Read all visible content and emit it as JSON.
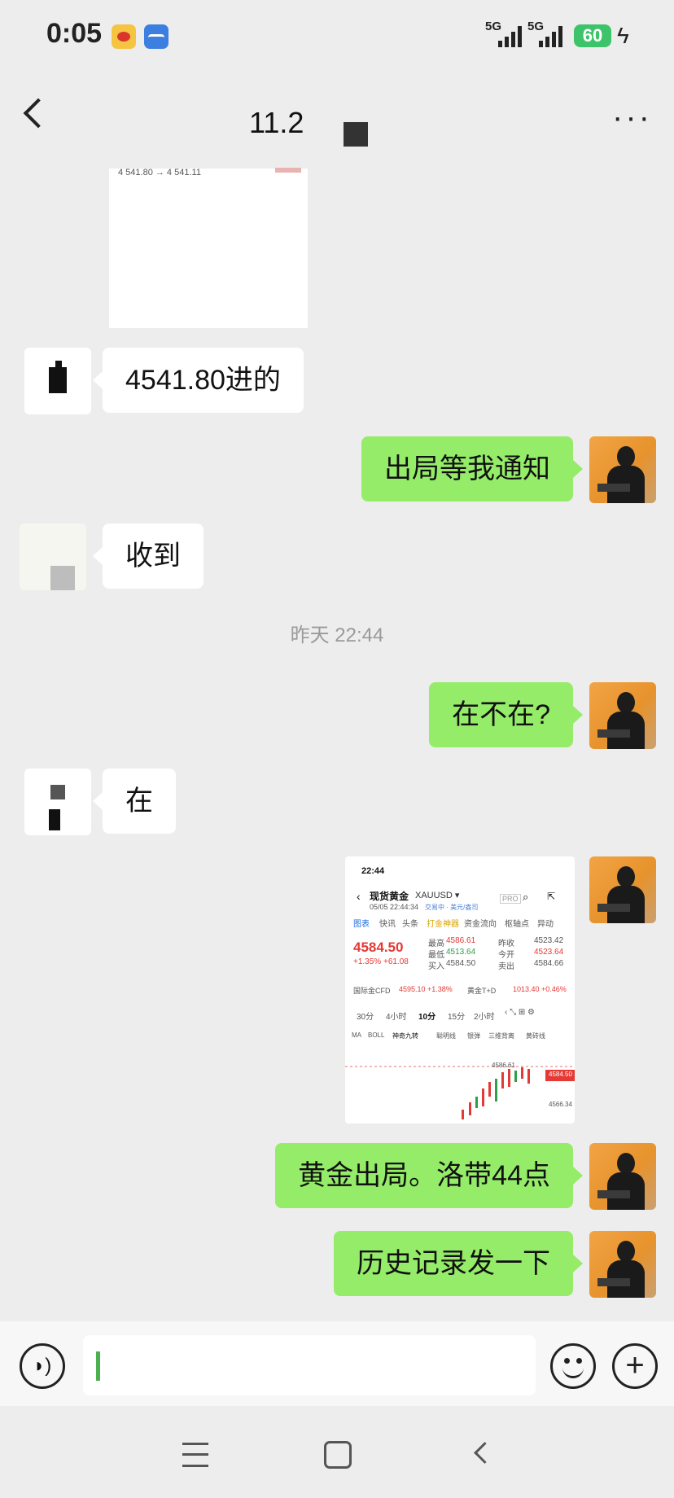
{
  "status_bar": {
    "time": "0:05",
    "signal1": "5G",
    "signal2": "5G",
    "battery": "60",
    "icons": [
      "weibo-icon",
      "stock-app-icon",
      "signal-icon",
      "battery-icon",
      "charging-icon"
    ]
  },
  "header": {
    "title": "11.2",
    "icons": [
      "back-icon",
      "more-icon"
    ]
  },
  "messages": [
    {
      "side": "in",
      "type": "image",
      "text": "4 541.80 → 4 541.11"
    },
    {
      "side": "in",
      "type": "text",
      "text": "4541.80进的"
    },
    {
      "side": "out",
      "type": "text",
      "text": "出局等我通知"
    },
    {
      "side": "in",
      "type": "text",
      "text": "收到"
    },
    {
      "side": "out",
      "type": "text",
      "text": "在不在?"
    },
    {
      "side": "in",
      "type": "text",
      "text": "在"
    },
    {
      "side": "out",
      "type": "image"
    },
    {
      "side": "out",
      "type": "text",
      "text": "黄金出局。洛带44点"
    },
    {
      "side": "out",
      "type": "text",
      "text": "历史记录发一下"
    }
  ],
  "timestamp": "昨天 22:44",
  "shared_screenshot": {
    "time": "22:44",
    "title": "现货黄金",
    "symbol": "XAUUSD ▾",
    "datetime": "05/05 22:44:34",
    "status_tags": "交易中  ·  美元/盎司",
    "pro": "PRO",
    "tabs": [
      "图表",
      "快讯",
      "头条",
      "打金神器",
      "资金流向",
      "枢轴点",
      "异动"
    ],
    "price": "4584.50",
    "change": "+1.35%  +61.08",
    "stats": [
      {
        "label": "最高",
        "value": "4586.61"
      },
      {
        "label": "昨收",
        "value": "4523.42"
      },
      {
        "label": "最低",
        "value": "4513.64"
      },
      {
        "label": "今开",
        "value": "4523.64"
      },
      {
        "label": "买入",
        "value": "4584.50"
      },
      {
        "label": "卖出",
        "value": "4584.66"
      }
    ],
    "cfd_label": "国际金CFD",
    "cfd_value": "4595.10  +1.38%",
    "td_label": "黄金T+D",
    "td_value": "1013.40  +0.46%",
    "periods": [
      "30分",
      "4小时",
      "10分",
      "15分",
      "2小时"
    ],
    "indicators": [
      "MA",
      "BOLL",
      "神奇九转",
      "聪明线",
      "银弹",
      "三维背离",
      "黄砖线"
    ],
    "chart_high": "4586.61",
    "chart_price_tag": "4584.50",
    "chart_low": "4566.34"
  },
  "input_bar": {
    "text": "",
    "icons": [
      "voice-icon",
      "emoji-icon",
      "plus-icon"
    ]
  },
  "system_nav": {
    "icons": [
      "menu-icon",
      "home-icon",
      "back-icon"
    ]
  }
}
